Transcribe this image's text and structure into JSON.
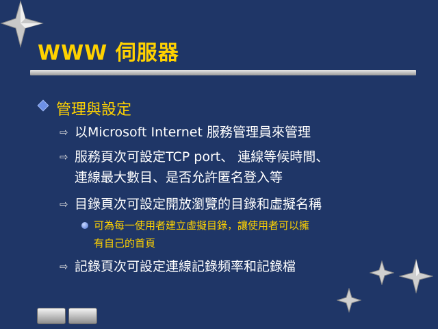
{
  "slide": {
    "title": "WWW 伺服器",
    "heading": "管理與設定",
    "items": [
      {
        "lines": [
          "以Microsoft Internet 服務管理員來管理"
        ]
      },
      {
        "lines": [
          "服務頁次可設定TCP port、 連線等候時間、",
          "連線最大數目、是否允許匿名登入等"
        ]
      },
      {
        "lines": [
          "目錄頁次可設定開放瀏覽的目錄和虛擬名稱"
        ]
      },
      {
        "lines": [
          "記錄頁次可設定連線記錄頻率和記錄檔"
        ]
      }
    ],
    "subitem": {
      "lines": [
        "可為每一使用者建立虛擬目錄，讓使用者可以擁",
        "有自己的首頁"
      ]
    }
  },
  "colors": {
    "background": "#1f3667",
    "title": "#ffd200",
    "text": "#ffffff",
    "bullet": "#6c90e6"
  },
  "icons": [
    "star-icon",
    "diamond-bullet-icon",
    "arrow-bullet-icon",
    "round-bullet-icon",
    "prev-slide-icon",
    "next-slide-icon"
  ]
}
